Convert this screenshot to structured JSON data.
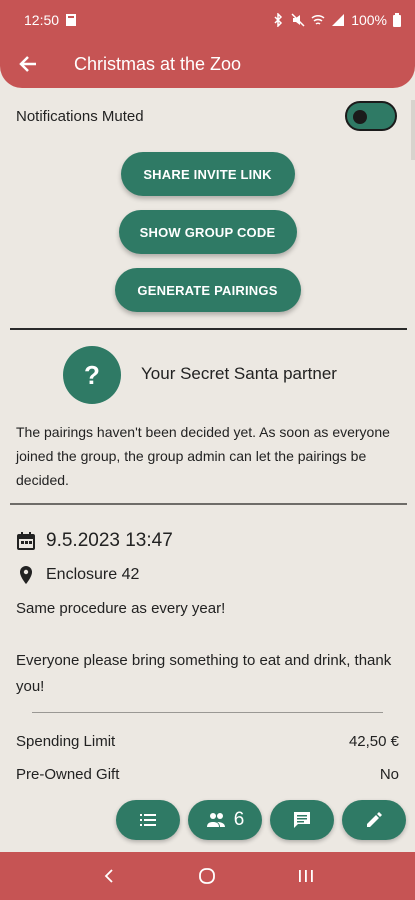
{
  "status": {
    "time": "12:50",
    "battery": "100%",
    "icons": [
      "bluetooth-icon",
      "mute-icon",
      "wifi-icon",
      "signal-icon",
      "battery-icon"
    ]
  },
  "header": {
    "title": "Christmas at the Zoo",
    "back_icon": "arrow-left-icon"
  },
  "notifications": {
    "label": "Notifications Muted",
    "toggle_on": true
  },
  "actions": {
    "share": "SHARE INVITE LINK",
    "code": "SHOW GROUP CODE",
    "generate": "GENERATE PAIRINGS"
  },
  "partner": {
    "avatar": "?",
    "label": "Your Secret Santa partner",
    "info": "The pairings haven't been decided yet. As soon as everyone joined the group, the group admin can let the pairings be decided."
  },
  "event": {
    "date": "9.5.2023 13:47",
    "location": "Enclosure 42",
    "description_1": "Same procedure as every year!",
    "description_2": "Everyone please bring something to eat and drink, thank you!"
  },
  "details": {
    "spending_label": "Spending Limit",
    "spending_value": "42,50 €",
    "preowned_label": "Pre-Owned Gift",
    "preowned_value": "No"
  },
  "fabs": {
    "members_count": "6",
    "icons": [
      "list-icon",
      "people-icon",
      "chat-icon",
      "edit-icon"
    ]
  },
  "colors": {
    "primary": "#c65454",
    "accent": "#2f7a65",
    "background": "#ece8e2"
  }
}
